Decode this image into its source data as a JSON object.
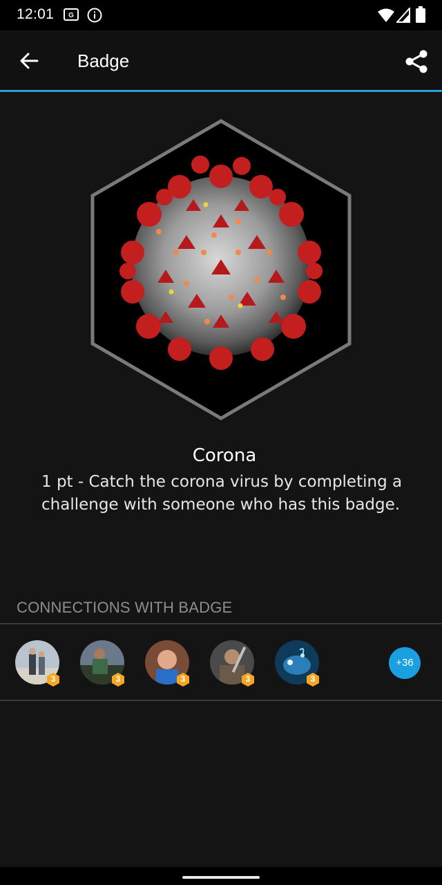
{
  "status_bar": {
    "time": "12:01",
    "icons": [
      "notification-box-icon",
      "info-circle-icon",
      "wifi-icon",
      "cell-signal-icon",
      "battery-icon"
    ]
  },
  "app_bar": {
    "title": "Badge",
    "back_icon": "arrow-left-icon",
    "share_icon": "share-icon",
    "accent_color": "#2a9fd8"
  },
  "badge": {
    "name": "Corona",
    "description": "1 pt - Catch the corona virus by completing a challenge with someone who has this badge.",
    "image": "coronavirus-hexagon-badge"
  },
  "connections": {
    "header": "CONNECTIONS WITH BADGE",
    "avatars": [
      {
        "label": "3"
      },
      {
        "label": "3"
      },
      {
        "label": "3"
      },
      {
        "label": "3"
      },
      {
        "label": "3"
      }
    ],
    "more_label": "+36",
    "more_color": "#1a9fe0",
    "level_badge_color": "#f5a623"
  }
}
